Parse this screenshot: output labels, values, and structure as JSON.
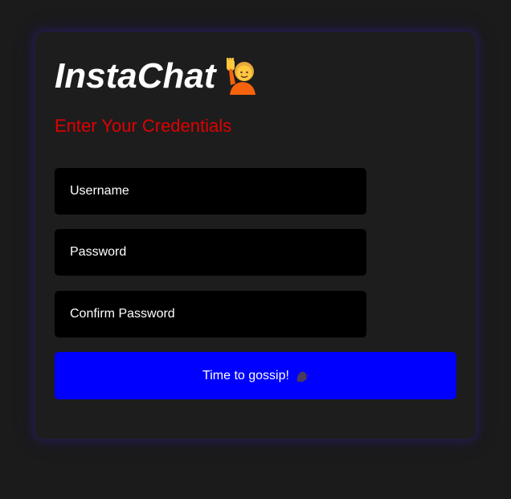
{
  "app": {
    "title": "InstaChat",
    "title_icon": "person-raising-hand-emoji"
  },
  "form": {
    "subtitle": "Enter Your Credentials",
    "username_placeholder": "Username",
    "password_placeholder": "Password",
    "confirm_password_placeholder": "Confirm Password",
    "submit_label": "Time to gossip!",
    "submit_icon": "speaking-head-emoji"
  },
  "colors": {
    "background": "#1b1b1b",
    "card": "#1d1d1d",
    "subtitle": "#e00000",
    "input_bg": "#000000",
    "button_bg": "#0000ff",
    "card_glow": "#2d1e6e"
  }
}
